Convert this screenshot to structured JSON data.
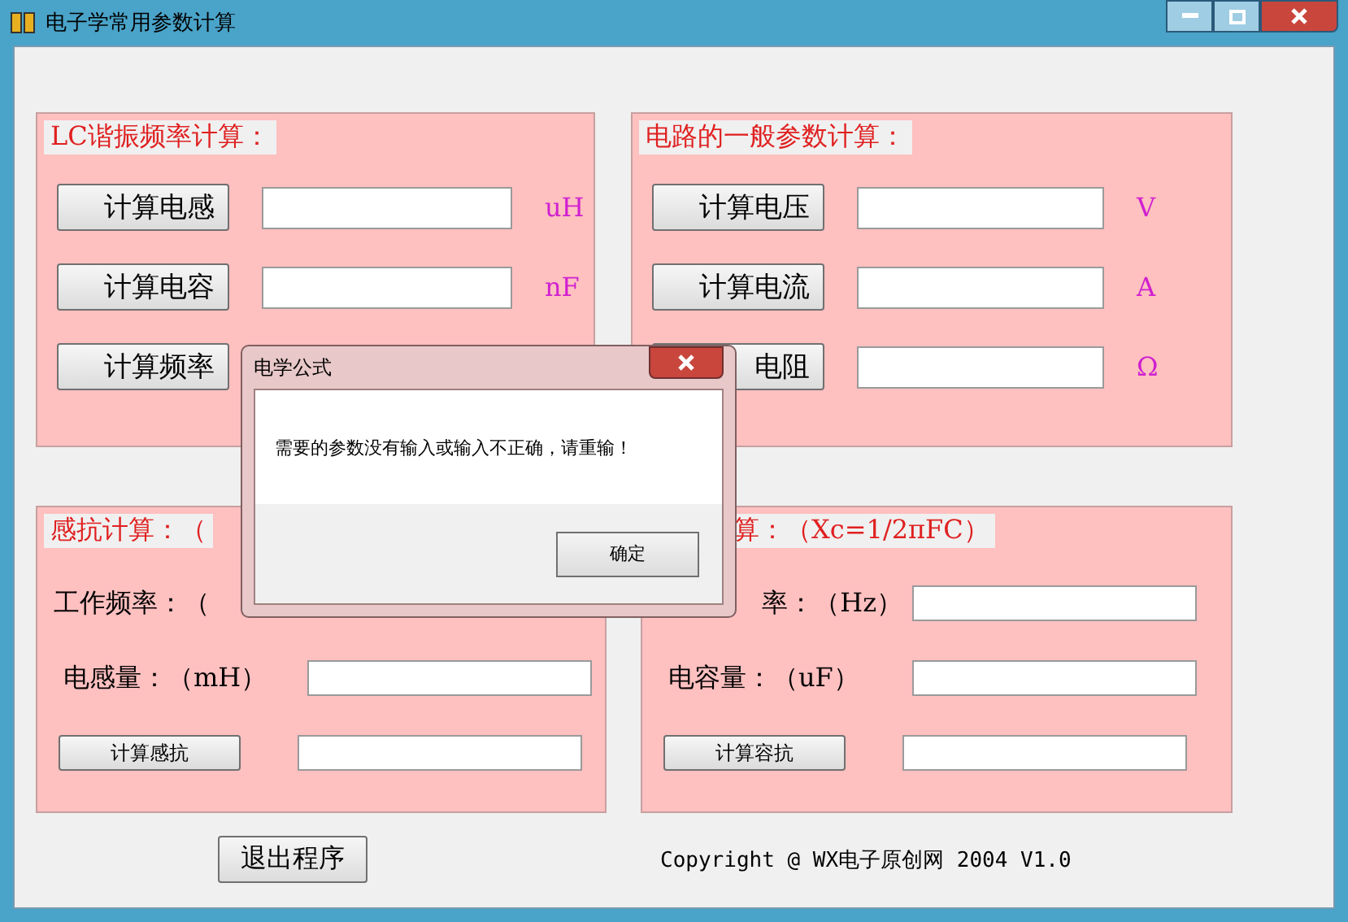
{
  "window": {
    "title": "电子学常用参数计算"
  },
  "lc_panel": {
    "title": "LC谐振频率计算：",
    "rows": [
      {
        "kind": "input",
        "button": "计算电感",
        "unit": "uH"
      },
      {
        "kind": "input",
        "button": "计算电容",
        "unit": "nF"
      },
      {
        "kind": "button_only",
        "button": "计算频率"
      }
    ]
  },
  "circuit_panel": {
    "title": "电路的一般参数计算：",
    "rows": [
      {
        "kind": "input",
        "button": "计算电压",
        "unit": "V"
      },
      {
        "kind": "input",
        "button": "计算电流",
        "unit": "A"
      },
      {
        "kind": "input",
        "button": "电阻",
        "unit": "Ω"
      }
    ]
  },
  "inductive_panel": {
    "title": "感抗计算：（",
    "rows": [
      {
        "kind": "label",
        "label": "工作频率：（"
      },
      {
        "kind": "label_input",
        "label": "电感量：（mH）"
      },
      {
        "kind": "button_input",
        "label": "计算感抗"
      }
    ]
  },
  "capacitive_panel": {
    "title": "算：（Xc=1/2πFC）",
    "rows": [
      {
        "kind": "cut_label_input",
        "label": "率：（Hz）"
      },
      {
        "kind": "label_input",
        "label": "电容量：（uF）"
      },
      {
        "kind": "button_input",
        "label": "计算容抗"
      }
    ]
  },
  "exit_button": "退出程序",
  "copyright": "Copyright @ WX电子原创网 2004 V1.0",
  "dialog": {
    "title": "电学公式",
    "message": "需要的参数没有输入或输入不正确，请重输！",
    "ok_button": "确定"
  }
}
